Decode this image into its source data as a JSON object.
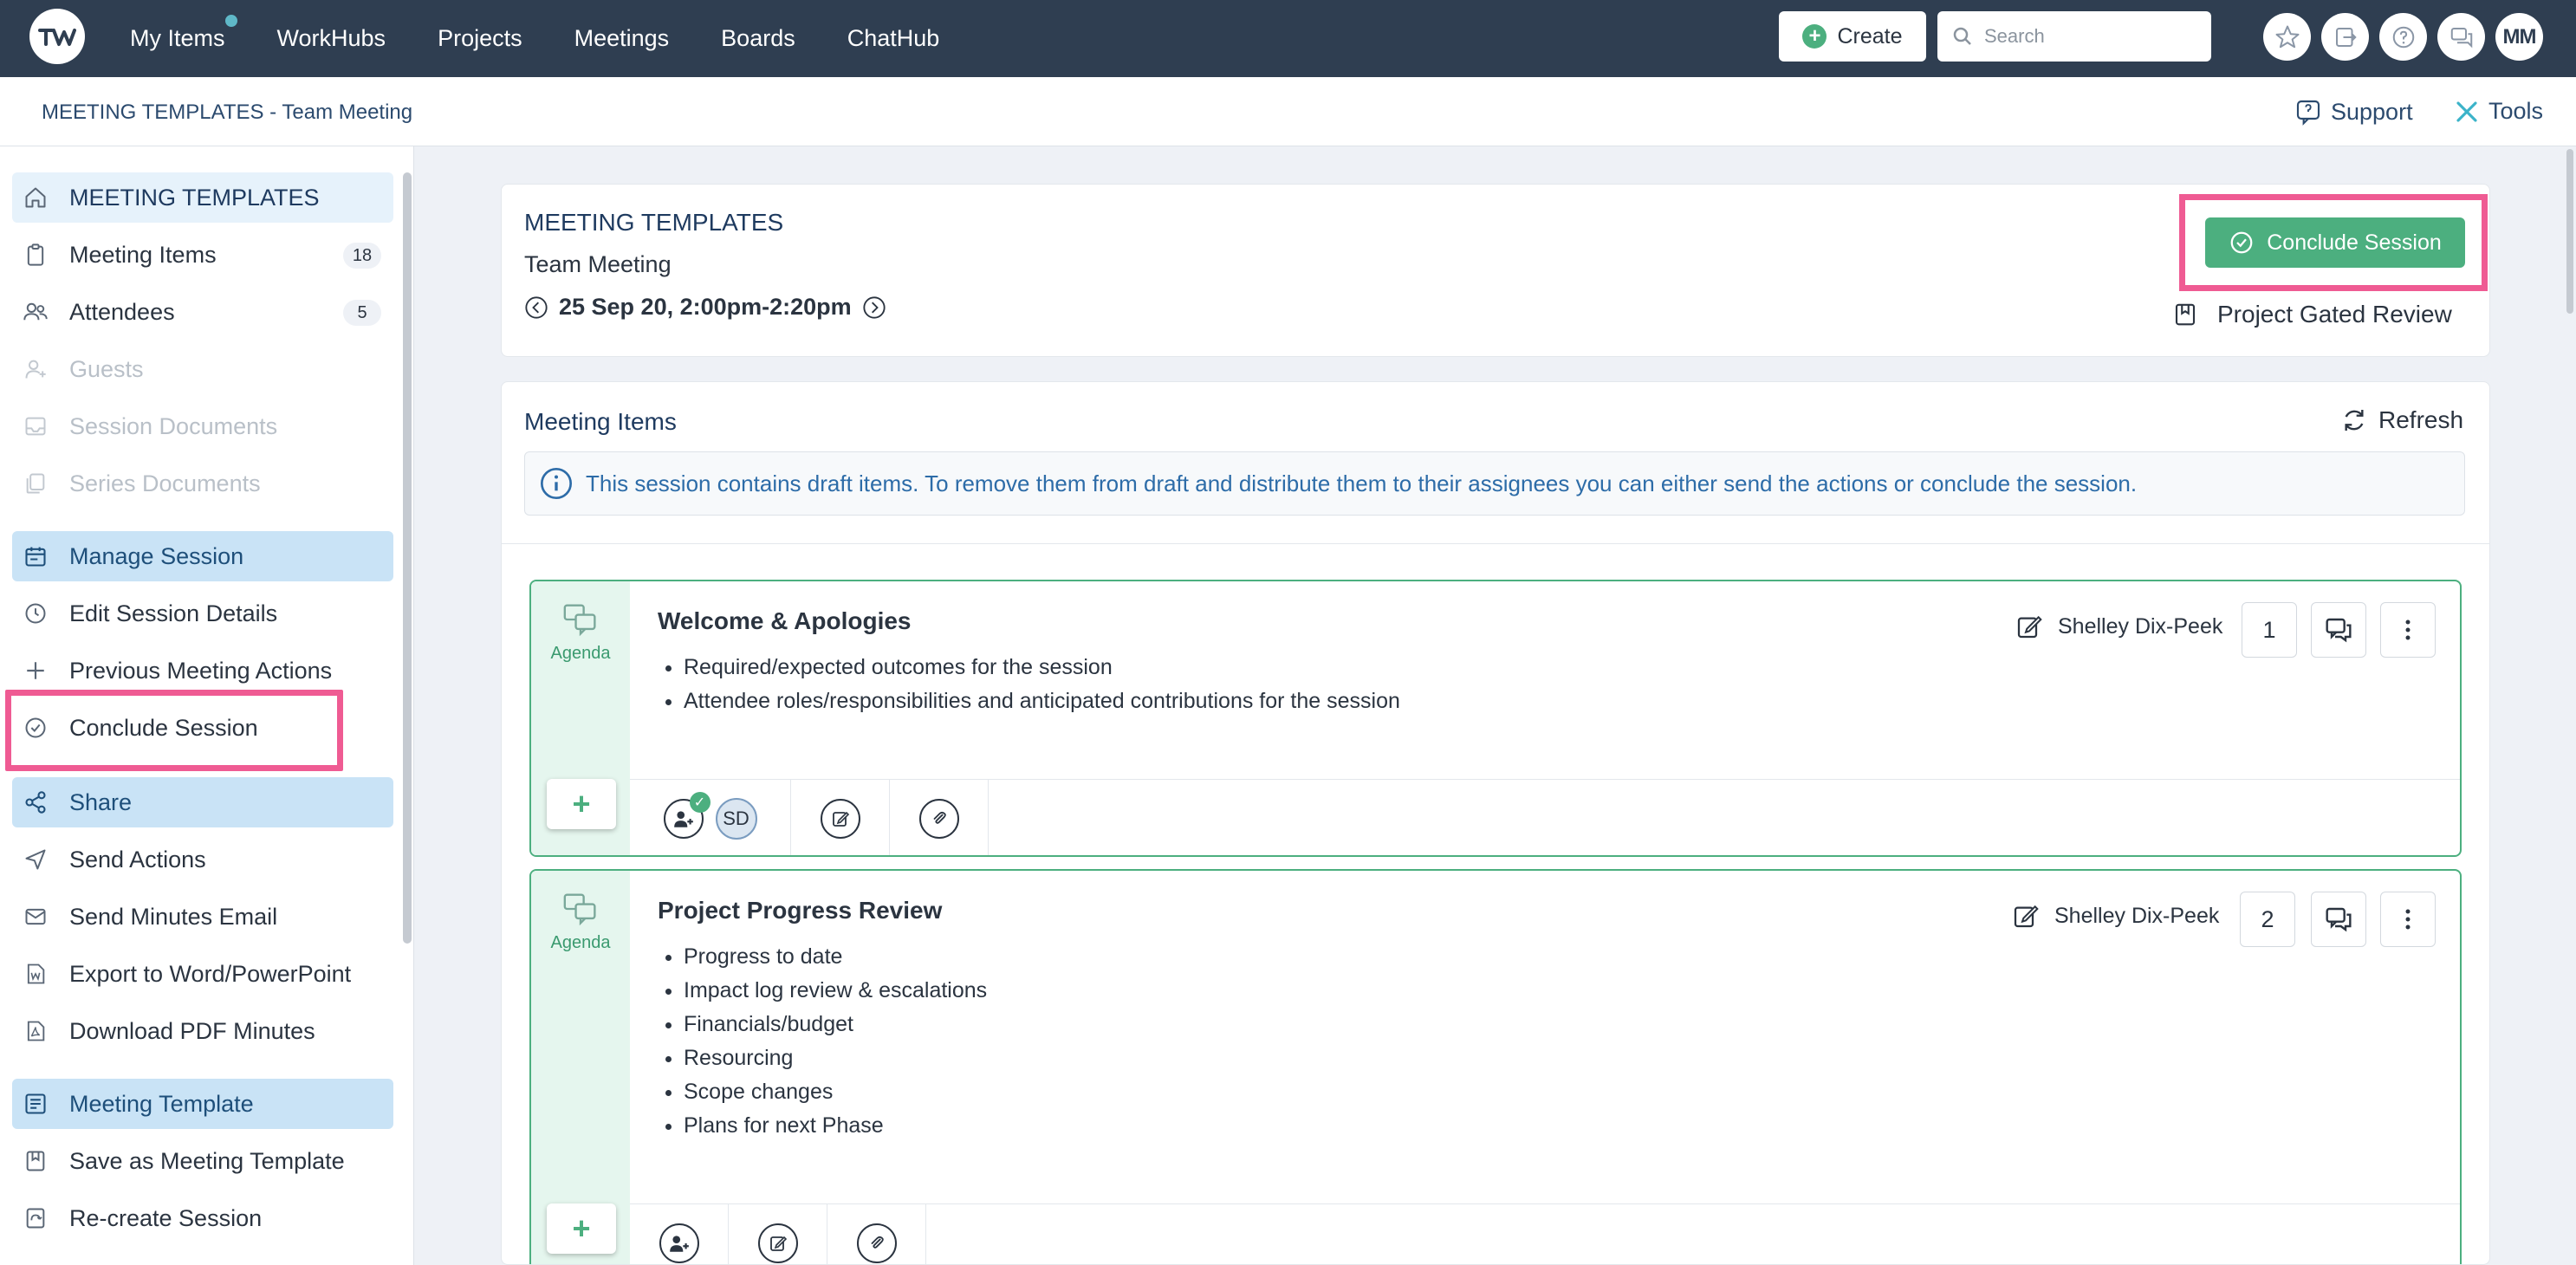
{
  "nav": {
    "items": [
      "My Items",
      "WorkHubs",
      "Projects",
      "Meetings",
      "Boards",
      "ChatHub"
    ]
  },
  "top": {
    "create_label": "Create",
    "search_placeholder": "Search",
    "avatar_initials": "MM"
  },
  "subbar": {
    "breadcrumb": "MEETING TEMPLATES - Team Meeting",
    "support": "Support",
    "tools": "Tools"
  },
  "sidebar": {
    "items": [
      {
        "label": "MEETING TEMPLATES",
        "icon": "home-icon"
      },
      {
        "label": "Meeting Items",
        "count": "18",
        "icon": "clipboard-icon"
      },
      {
        "label": "Attendees",
        "count": "5",
        "icon": "people-icon"
      },
      {
        "label": "Guests",
        "icon": "guest-icon"
      },
      {
        "label": "Session Documents",
        "icon": "inbox-icon"
      },
      {
        "label": "Series Documents",
        "icon": "copy-icon"
      },
      {
        "label": "Manage Session",
        "icon": "calendar-icon"
      },
      {
        "label": "Edit Session Details",
        "icon": "clock-icon"
      },
      {
        "label": "Previous Meeting Actions",
        "icon": "plus-icon"
      },
      {
        "label": "Conclude Session",
        "icon": "check-circle-icon"
      },
      {
        "label": "Share",
        "icon": "share-icon"
      },
      {
        "label": "Send Actions",
        "icon": "send-icon"
      },
      {
        "label": "Send Minutes Email",
        "icon": "mail-icon"
      },
      {
        "label": "Export to Word/PowerPoint",
        "icon": "word-icon"
      },
      {
        "label": "Download PDF Minutes",
        "icon": "pdf-icon"
      },
      {
        "label": "Meeting Template",
        "icon": "template-icon"
      },
      {
        "label": "Save as Meeting Template",
        "icon": "bookmark-icon"
      },
      {
        "label": "Re-create Session",
        "icon": "recreate-icon"
      }
    ]
  },
  "header": {
    "title": "MEETING TEMPLATES",
    "subtitle": "Team Meeting",
    "date": "25 Sep 20, 2:00pm-2:20pm",
    "conclude_label": "Conclude Session",
    "gated_label": "Project Gated Review"
  },
  "panel": {
    "title": "Meeting Items",
    "refresh": "Refresh",
    "info": "This session contains draft items. To remove them from draft and distribute them to their assignees you can either send the actions or conclude the session."
  },
  "items": [
    {
      "type": "Agenda",
      "title": "Welcome & Apologies",
      "bullets": [
        "Required/expected outcomes for the session",
        "Attendee roles/responsibilities and anticipated contributions for the session"
      ],
      "owner": "Shelley Dix-Peek",
      "number": "1",
      "attendee_initials": "SD"
    },
    {
      "type": "Agenda",
      "title": "Project Progress Review",
      "bullets": [
        "Progress to date",
        "Impact log review & escalations",
        "Financials/budget",
        "Resourcing",
        "Scope changes",
        "Plans for next Phase"
      ],
      "owner": "Shelley Dix-Peek",
      "number": "2"
    }
  ],
  "colors": {
    "accent_green": "#4caf7f",
    "highlight_pink": "#ef5b93",
    "topbar": "#2f3e51"
  }
}
